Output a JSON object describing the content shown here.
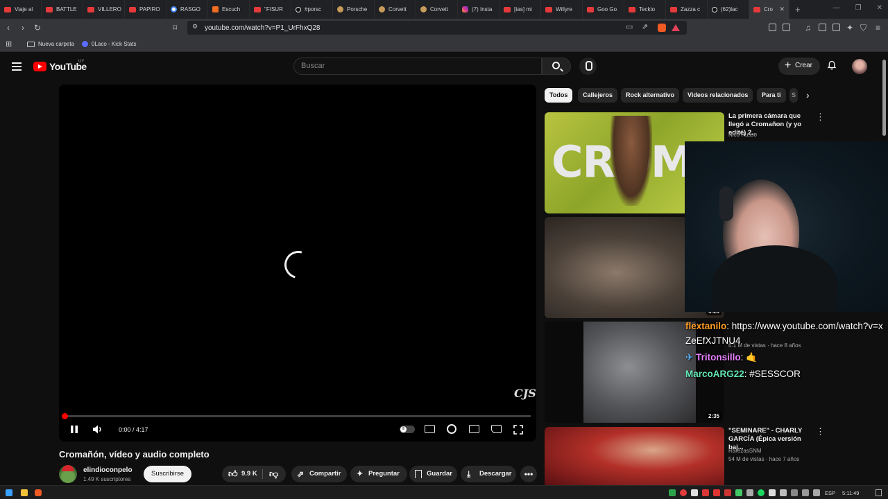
{
  "browser": {
    "tabs": [
      {
        "label": "Viaje al",
        "icon": "youtube-icon"
      },
      {
        "label": "BATTLE",
        "icon": "youtube-icon"
      },
      {
        "label": "VILLERO",
        "icon": "youtube-icon"
      },
      {
        "label": "PAPIRO",
        "icon": "youtube-icon"
      },
      {
        "label": "RASGO",
        "icon": "google-icon"
      },
      {
        "label": "Escuch",
        "icon": "soundcloud-icon"
      },
      {
        "label": "\"FISUR",
        "icon": "youtube-icon"
      },
      {
        "label": "#porsc",
        "icon": "tiktok-icon"
      },
      {
        "label": "Porsche",
        "icon": "claude-icon"
      },
      {
        "label": "Corvett",
        "icon": "claude-icon"
      },
      {
        "label": "Corvett",
        "icon": "claude-icon"
      },
      {
        "label": "(7) Insta",
        "icon": "instagram-icon"
      },
      {
        "label": "[tas] mi",
        "icon": "youtube-icon"
      },
      {
        "label": "Willyre",
        "icon": "youtube-icon"
      },
      {
        "label": "Goo Go",
        "icon": "youtube-icon"
      },
      {
        "label": "Teckto",
        "icon": "youtube-icon"
      },
      {
        "label": "Zazza c",
        "icon": "youtube-icon"
      },
      {
        "label": "(62)lac",
        "icon": "tiktok-icon"
      },
      {
        "label": "Cro",
        "icon": "youtube-icon",
        "active": true
      }
    ],
    "url": "youtube.com/watch?v=P1_UrFhxQ28",
    "bookmarks": [
      {
        "label": "Nueva carpeta",
        "icon": "folder-icon"
      },
      {
        "label": "0Laco - Kick Stats",
        "icon": "kick-icon"
      }
    ]
  },
  "masthead": {
    "logo_text": "YouTube",
    "country": "UY",
    "search_placeholder": "Buscar",
    "create_label": "Crear"
  },
  "player": {
    "time": "0:00 / 4:17",
    "progress_fraction": 0.0,
    "watermark": "CJS"
  },
  "video": {
    "title": "Cromañón, vídeo y audio completo",
    "channel": "elindioconpelo",
    "subscribers": "1.49 K suscriptores",
    "subscribe_label": "Suscribirse",
    "likes": "9.9 K",
    "share_label": "Compartir",
    "ask_label": "Preguntar",
    "save_label": "Guardar",
    "download_label": "Descargar"
  },
  "chips": [
    "Todos",
    "Callejeros",
    "Rock alternativo",
    "Videos relacionados",
    "Para ti",
    "S"
  ],
  "related": [
    {
      "title": "La primera cámara que llegó a Cromañon (y yo edité) 2...",
      "channel": "Nico Russo",
      "meta": "",
      "duration": "",
      "thumb_text": "CROMAÑ"
    },
    {
      "title": "",
      "channel": "",
      "meta": "",
      "duration": "5:23",
      "thumb_text": ""
    },
    {
      "title": "",
      "channel": "",
      "meta": "6.1 M de vistas · hace 8 años",
      "duration": "2:35",
      "thumb_text": ""
    },
    {
      "title": "\"SEMINARE\" - CHARLY GARCÍA (Épica versión baj...",
      "channel": "RarezasSNM",
      "meta": "54 M de vistas · hace 7 años",
      "duration": "",
      "thumb_text": ""
    }
  ],
  "chat": [
    {
      "user": "flextanilo",
      "message": "https://www.youtube.com/watch?v=xZeEfXJTNU4"
    },
    {
      "user": "Tritonsillo",
      "message": "🤙"
    },
    {
      "user": "MarcoARG22",
      "message": "#SESSCOR"
    }
  ],
  "taskbar": {
    "language": "ESP",
    "clock": "5:11:49"
  }
}
